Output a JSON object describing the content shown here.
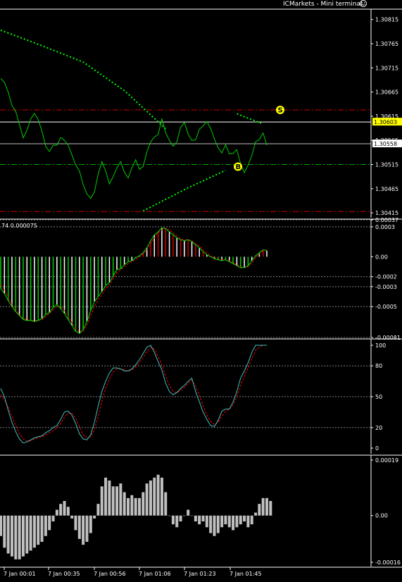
{
  "window": {
    "title": "ICMarkets - Mini terminal",
    "smiley_icon": "smiley-face-icon"
  },
  "colors": {
    "background": "#000000",
    "price_line": "#00cc00",
    "dotted_line": "#00ff00",
    "sell_level": "#cc0000",
    "buy_level": "#00aa00",
    "grid": "#808080",
    "axis_text": "#ffffff",
    "highlight": "#ffff00",
    "signal_red": "#ff0000",
    "histogram_gray": "#c0c0c0",
    "histogram_white": "#ffffff"
  },
  "markers": {
    "sell_label": "S",
    "buy_label": "B"
  },
  "x_labels": [
    "7 Jan 00:01",
    "7 Jan 00:35",
    "7 Jan 00:56",
    "7 Jan 01:06",
    "7 Jan 01:23",
    "7 Jan 01:45"
  ],
  "chart_data": [
    {
      "type": "line",
      "panel": "price",
      "y_ticks": [
        "1.30815",
        "1.30765",
        "1.30715",
        "1.30665",
        "1.30615",
        "1.30565",
        "1.30515",
        "1.30465",
        "1.30415"
      ],
      "ylim": [
        1.30405,
        1.30835
      ],
      "current_price": "1.30603",
      "last_price": "1.30558",
      "levels": {
        "sell": 1.30628,
        "buy": 1.30515,
        "lower": 1.30418,
        "upper_line": 1.30603,
        "last_line": 1.30558
      },
      "series": [
        {
          "values": [
            1.30693,
            1.30685,
            1.30665,
            1.30637,
            1.30625,
            1.30598,
            1.3057,
            1.30586,
            1.30609,
            1.30621,
            1.30608,
            1.30584,
            1.30553,
            1.30542,
            1.30555,
            1.30555,
            1.30571,
            1.30565,
            1.30555,
            1.30535,
            1.30514,
            1.30502,
            1.30474,
            1.30454,
            1.30445,
            1.30458,
            1.30495,
            1.30521,
            1.30502,
            1.30475,
            1.3049,
            1.30508,
            1.30521,
            1.30499,
            1.30487,
            1.30508,
            1.30525,
            1.30505,
            1.30511,
            1.30541,
            1.30562,
            1.30572,
            1.30577,
            1.30609,
            1.30581,
            1.30565,
            1.30553,
            1.30562,
            1.30592,
            1.30602,
            1.30578,
            1.30565,
            1.30566,
            1.30588,
            1.30595,
            1.30604,
            1.3059,
            1.30568,
            1.3055,
            1.30539,
            1.30556,
            1.30537,
            1.30538,
            1.30546,
            1.30517,
            1.30498,
            1.30514,
            1.30534,
            1.30562,
            1.30567,
            1.3058,
            1.30555
          ]
        }
      ],
      "dotted_upper": [
        {
          "x": 0,
          "y": 1.30793
        },
        {
          "x": 11,
          "y": 1.30761
        },
        {
          "x": 22,
          "y": 1.30727
        },
        {
          "x": 33,
          "y": 1.30668
        },
        {
          "x": 44,
          "y": 1.30589
        }
      ],
      "dotted_upper_tail": [
        {
          "x": 63,
          "y": 1.3062
        },
        {
          "x": 70,
          "y": 1.30599
        }
      ],
      "dotted_lower": [
        {
          "x": 38,
          "y": 1.30419
        },
        {
          "x": 50,
          "y": 1.30467
        },
        {
          "x": 60,
          "y": 1.30503
        }
      ]
    },
    {
      "type": "line",
      "panel": "oscillator-1",
      "header": "74 0.000075",
      "y_ticks": [
        "0.00037",
        "0.0003",
        "0.00",
        "-0.0002",
        "-0.0003",
        "-0.0005",
        "-0.00081"
      ],
      "ylim": [
        -0.00081,
        0.00037
      ],
      "series": [
        {
          "name": "main",
          "values": [
            -0.00032,
            -0.00037,
            -0.00044,
            -0.0005,
            -0.00055,
            -0.00059,
            -0.00063,
            -0.00064,
            -0.00064,
            -0.00065,
            -0.00064,
            -0.00062,
            -0.00058,
            -0.00056,
            -0.00051,
            -0.00048,
            -0.00052,
            -0.00057,
            -0.00063,
            -0.00069,
            -0.00075,
            -0.00077,
            -0.00073,
            -0.00065,
            -0.00054,
            -0.00045,
            -0.0004,
            -0.00035,
            -0.00029,
            -0.00026,
            -0.00019,
            -0.00013,
            -0.00012,
            -8e-05,
            -5e-05,
            -4e-05,
            -1e-05,
            1e-05,
            4e-05,
            9e-05,
            0.00016,
            0.00022,
            0.00025,
            0.00029,
            0.00028,
            0.00025,
            0.00022,
            0.00019,
            0.00017,
            0.00016,
            0.00017,
            0.00015,
            0.00012,
            9e-05,
            5e-05,
            2e-05,
            0.0,
            -2e-05,
            -3e-05,
            -4e-05,
            -3e-05,
            -5e-05,
            -7e-05,
            -9e-05,
            -0.00011,
            -0.00011,
            -9e-05,
            -4e-05,
            1e-05,
            4e-05,
            7e-05,
            6e-05
          ]
        },
        {
          "name": "signal",
          "values": [
            -0.00028,
            -0.00033,
            -0.00041,
            -0.00048,
            -0.00053,
            -0.00058,
            -0.00062,
            -0.00063,
            -0.00064,
            -0.00064,
            -0.00064,
            -0.00063,
            -0.0006,
            -0.00057,
            -0.00053,
            -0.0005,
            -0.0005,
            -0.00054,
            -0.0006,
            -0.00066,
            -0.00072,
            -0.00076,
            -0.00075,
            -0.00069,
            -0.00059,
            -0.0005,
            -0.00043,
            -0.00038,
            -0.00032,
            -0.00028,
            -0.00022,
            -0.00016,
            -0.00013,
            -0.0001,
            -7e-05,
            -5e-05,
            -3e-05,
            0.0,
            3e-05,
            7e-05,
            0.00013,
            0.00019,
            0.00024,
            0.00027,
            0.00029,
            0.00027,
            0.00024,
            0.00021,
            0.00018,
            0.00017,
            0.00017,
            0.00016,
            0.00013,
            0.00011,
            7e-05,
            4e-05,
            1e-05,
            -1e-05,
            -2e-05,
            -3e-05,
            -3e-05,
            -4e-05,
            -6e-05,
            -8e-05,
            -0.0001,
            -0.00011,
            -0.0001,
            -6e-05,
            -1e-05,
            3e-05,
            6e-05,
            7e-05
          ]
        }
      ]
    },
    {
      "type": "line",
      "panel": "oscillator-2",
      "y_ticks": [
        "100",
        "80",
        "50",
        "20",
        "0"
      ],
      "ylim": [
        0,
        100
      ],
      "series": [
        {
          "name": "main",
          "values": [
            58,
            50,
            37,
            25,
            16,
            9,
            5,
            6,
            8,
            10,
            11,
            12,
            15,
            17,
            20,
            22,
            28,
            35,
            36,
            32,
            24,
            14,
            9,
            8,
            13,
            25,
            41,
            55,
            65,
            73,
            78,
            78,
            77,
            75,
            75,
            77,
            81,
            86,
            92,
            98,
            100,
            93,
            84,
            76,
            63,
            55,
            52,
            54,
            58,
            61,
            65,
            68,
            55,
            45,
            35,
            28,
            22,
            21,
            27,
            36,
            38,
            38,
            45,
            55,
            68,
            75,
            83,
            93,
            100,
            100,
            100,
            100
          ]
        },
        {
          "name": "signal",
          "values": [
            52,
            47,
            40,
            31,
            22,
            14,
            9,
            7,
            7,
            9,
            10,
            11,
            13,
            15,
            17,
            20,
            24,
            30,
            34,
            34,
            29,
            21,
            13,
            10,
            11,
            18,
            31,
            46,
            58,
            67,
            74,
            77,
            77,
            76,
            75,
            76,
            79,
            83,
            88,
            94,
            98,
            96,
            89,
            81,
            70,
            61,
            55,
            54,
            56,
            59,
            63,
            66,
            60,
            51,
            41,
            32,
            26,
            23,
            25,
            31,
            36,
            38,
            42,
            50,
            61,
            70,
            78,
            87,
            95,
            98,
            100,
            100
          ]
        }
      ]
    },
    {
      "type": "bar",
      "panel": "histogram",
      "y_ticks": [
        "0.00019",
        "0.00",
        "-0.00016"
      ],
      "ylim": [
        -0.00016,
        0.00019
      ],
      "values": [
        -7e-05,
        -0.00011,
        -0.00013,
        -0.00014,
        -0.00015,
        -0.00015,
        -0.00014,
        -0.00013,
        -0.00012,
        -0.00011,
        -0.0001,
        -9e-05,
        -7e-05,
        -5e-05,
        -2e-05,
        2e-05,
        4e-05,
        5e-05,
        3e-05,
        -1e-05,
        -5e-05,
        -8e-05,
        -0.0001,
        -9e-05,
        -6e-05,
        -1e-05,
        4e-05,
        0.0001,
        0.00013,
        0.00012,
        0.0001,
        0.0001,
        0.00011,
        8e-05,
        6e-05,
        7e-05,
        6e-05,
        6e-05,
        8e-05,
        0.00011,
        0.00012,
        0.00013,
        0.00014,
        0.00013,
        8e-05,
        0.0,
        -3e-05,
        -4e-05,
        -2e-05,
        0.0,
        2e-05,
        0.0,
        -2e-05,
        -3e-05,
        -2e-05,
        -4e-05,
        -6e-05,
        -7e-05,
        -6e-05,
        -4e-05,
        -3e-05,
        -4e-05,
        -5e-05,
        -4e-05,
        -3e-05,
        -2e-05,
        -4e-05,
        -3e-05,
        1e-05,
        4e-05,
        6e-05,
        6e-05,
        5e-05
      ]
    }
  ]
}
